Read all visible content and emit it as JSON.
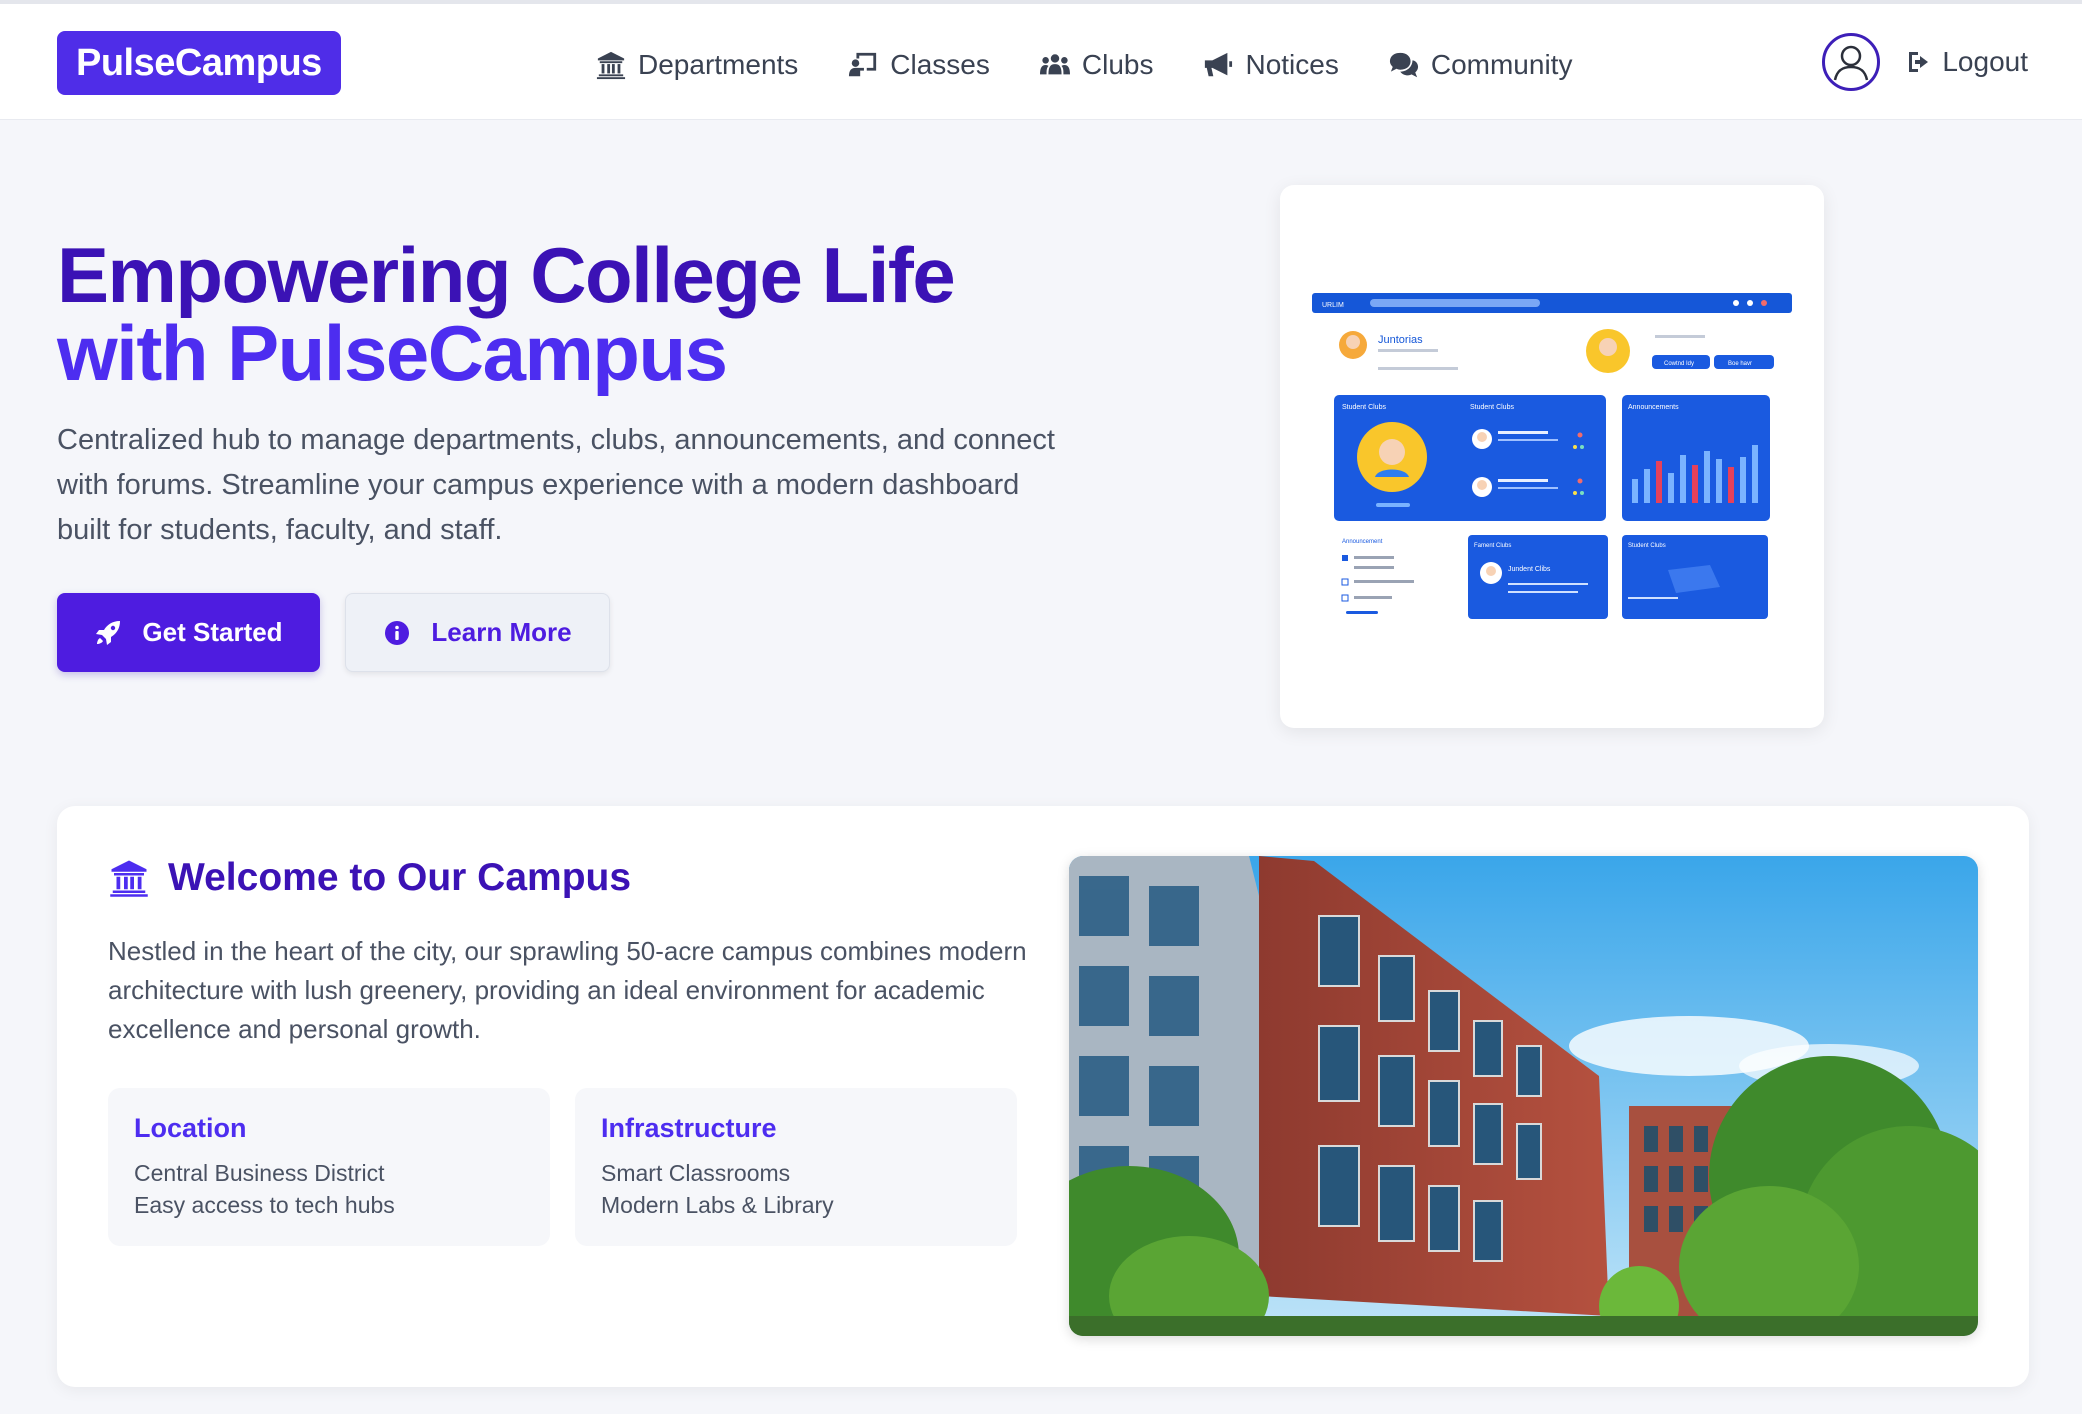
{
  "brand": {
    "name": "PulseCampus"
  },
  "nav": {
    "items": [
      {
        "label": "Departments",
        "icon": "university-icon"
      },
      {
        "label": "Classes",
        "icon": "chalkboard-teacher-icon"
      },
      {
        "label": "Clubs",
        "icon": "users-icon"
      },
      {
        "label": "Notices",
        "icon": "megaphone-icon"
      },
      {
        "label": "Community",
        "icon": "comments-icon"
      }
    ],
    "logout_label": "Logout"
  },
  "hero": {
    "title_line1": "Empowering College Life",
    "title_line2": "with PulseCampus",
    "description": "Centralized hub to manage departments, clubs, announcements, and connect with forums. Streamline your campus experience with a modern dashboard built for students, faculty, and staff.",
    "primary_button": "Get Started",
    "secondary_button": "Learn More"
  },
  "preview": {
    "header_label": "URLIM",
    "profile_name": "Juntorias",
    "panel_labels": [
      "Student Clubs",
      "Student Clubs",
      "Announcements",
      "Announcement",
      "Fament Clubs",
      "Student Clubs",
      "Jundent Clibs"
    ],
    "button_labels": [
      "Cowtnd Idy",
      "Boe havr"
    ]
  },
  "welcome": {
    "heading": "Welcome to Our Campus",
    "description": "Nestled in the heart of the city, our sprawling 50-acre campus combines modern architecture with lush greenery, providing an ideal environment for academic excellence and personal growth.",
    "boxes": [
      {
        "title": "Location",
        "line1": "Central Business District",
        "line2": "Easy access to tech hubs"
      },
      {
        "title": "Infrastructure",
        "line1": "Smart Classrooms",
        "line2": "Modern Labs & Library"
      }
    ]
  },
  "colors": {
    "brand": "#4f2de8",
    "heading_dark": "#3b12b5",
    "heading_light": "#4d2df0",
    "primary_button": "#4e1ce0",
    "page_bg": "#f5f6fa"
  }
}
